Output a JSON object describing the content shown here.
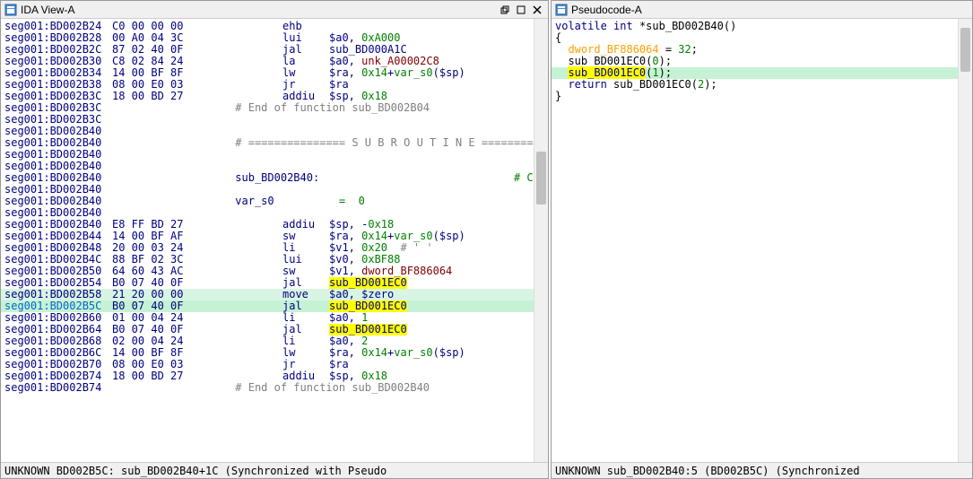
{
  "left": {
    "title": "IDA View-A",
    "status": "UNKNOWN BD002B5C: sub_BD002B40+1C (Synchronized with Pseudo",
    "lines": [
      {
        "addr": "seg001:BD002B24",
        "bytes": "C0 00 00 00",
        "mnem": "ehb",
        "op": ""
      },
      {
        "addr": "seg001:BD002B28",
        "bytes": "00 A0 04 3C",
        "mnem": "lui",
        "op": "$a0, 0xA000",
        "opparts": [
          {
            "t": "$a0, "
          },
          {
            "t": "0xA000",
            "c": "num"
          }
        ]
      },
      {
        "addr": "seg001:BD002B2C",
        "bytes": "87 02 40 0F",
        "mnem": "jal",
        "op": "sub_BD000A1C",
        "opparts": [
          {
            "t": "sub_BD000A1C",
            "c": ""
          }
        ]
      },
      {
        "addr": "seg001:BD002B30",
        "bytes": "C8 02 84 24",
        "mnem": "la",
        "op": "$a0, unk_A00002C8",
        "opparts": [
          {
            "t": "$a0, "
          },
          {
            "t": "unk_A00002C8",
            "c": "ref"
          }
        ]
      },
      {
        "addr": "seg001:BD002B34",
        "bytes": "14 00 BF 8F",
        "mnem": "lw",
        "op": "$ra, 0x14+var_s0($sp)",
        "opparts": [
          {
            "t": "$ra, "
          },
          {
            "t": "0x14",
            "c": "num"
          },
          {
            "t": "+"
          },
          {
            "t": "var_s0",
            "c": "num"
          },
          {
            "t": "($sp)"
          }
        ]
      },
      {
        "addr": "seg001:BD002B38",
        "bytes": "08 00 E0 03",
        "mnem": "jr",
        "op": "$ra"
      },
      {
        "addr": "seg001:BD002B3C",
        "bytes": "18 00 BD 27",
        "mnem": "addiu",
        "op": "$sp, 0x18",
        "opparts": [
          {
            "t": "$sp, "
          },
          {
            "t": "0x18",
            "c": "num"
          }
        ]
      },
      {
        "addr": "seg001:BD002B3C",
        "cmt": "# End of function sub_BD002B04"
      },
      {
        "addr": "seg001:BD002B3C"
      },
      {
        "addr": "seg001:BD002B40"
      },
      {
        "addr": "seg001:BD002B40",
        "cmt": "# =============== S U B R O U T I N E ========="
      },
      {
        "addr": "seg001:BD002B40"
      },
      {
        "addr": "seg001:BD002B40"
      },
      {
        "addr": "seg001:BD002B40",
        "label": "sub_BD002B40:",
        "xref": "# CODE XREF: SY"
      },
      {
        "addr": "seg001:BD002B40"
      },
      {
        "addr": "seg001:BD002B40",
        "label": "var_s0",
        "eq": "=  0"
      },
      {
        "addr": "seg001:BD002B40"
      },
      {
        "addr": "seg001:BD002B40",
        "bytes": "E8 FF BD 27",
        "mnem": "addiu",
        "op": "$sp, -0x18",
        "opparts": [
          {
            "t": "$sp, -"
          },
          {
            "t": "0x18",
            "c": "num"
          }
        ]
      },
      {
        "addr": "seg001:BD002B44",
        "bytes": "14 00 BF AF",
        "mnem": "sw",
        "op": "$ra, 0x14+var_s0($sp)",
        "opparts": [
          {
            "t": "$ra, "
          },
          {
            "t": "0x14",
            "c": "num"
          },
          {
            "t": "+"
          },
          {
            "t": "var_s0",
            "c": "num"
          },
          {
            "t": "($sp)"
          }
        ]
      },
      {
        "addr": "seg001:BD002B48",
        "bytes": "20 00 03 24",
        "mnem": "li",
        "op": "$v1, 0x20  # ' '",
        "opparts": [
          {
            "t": "$v1, "
          },
          {
            "t": "0x20",
            "c": "num"
          },
          {
            "t": "  # ' '",
            "c": "cmt"
          }
        ]
      },
      {
        "addr": "seg001:BD002B4C",
        "bytes": "88 BF 02 3C",
        "mnem": "lui",
        "op": "$v0, 0xBF88",
        "opparts": [
          {
            "t": "$v0, "
          },
          {
            "t": "0xBF88",
            "c": "num"
          }
        ]
      },
      {
        "addr": "seg001:BD002B50",
        "bytes": "64 60 43 AC",
        "mnem": "sw",
        "op": "$v1, dword_BF886064",
        "opparts": [
          {
            "t": "$v1, "
          },
          {
            "t": "dword_BF886064",
            "c": "ref"
          }
        ]
      },
      {
        "addr": "seg001:BD002B54",
        "bytes": "B0 07 40 0F",
        "mnem": "jal",
        "op": "sub_BD001EC0",
        "hl": true
      },
      {
        "addr": "seg001:BD002B58",
        "bytes": "21 20 00 00",
        "mnem": "move",
        "op": "$a0, $zero",
        "sel": "sel2"
      },
      {
        "addr": "seg001:BD002B5C",
        "bytes": "B0 07 40 0F",
        "mnem": "jal",
        "op": "sub_BD001EC0",
        "hl": true,
        "sel": "sel",
        "cur": true
      },
      {
        "addr": "seg001:BD002B60",
        "bytes": "01 00 04 24",
        "mnem": "li",
        "op": "$a0, 1",
        "opparts": [
          {
            "t": "$a0, "
          },
          {
            "t": "1",
            "c": "num"
          }
        ]
      },
      {
        "addr": "seg001:BD002B64",
        "bytes": "B0 07 40 0F",
        "mnem": "jal",
        "op": "sub_BD001EC0",
        "hl": true
      },
      {
        "addr": "seg001:BD002B68",
        "bytes": "02 00 04 24",
        "mnem": "li",
        "op": "$a0, 2",
        "opparts": [
          {
            "t": "$a0, "
          },
          {
            "t": "2",
            "c": "num"
          }
        ]
      },
      {
        "addr": "seg001:BD002B6C",
        "bytes": "14 00 BF 8F",
        "mnem": "lw",
        "op": "$ra, 0x14+var_s0($sp)",
        "opparts": [
          {
            "t": "$ra, "
          },
          {
            "t": "0x14",
            "c": "num"
          },
          {
            "t": "+"
          },
          {
            "t": "var_s0",
            "c": "num"
          },
          {
            "t": "($sp)"
          }
        ]
      },
      {
        "addr": "seg001:BD002B70",
        "bytes": "08 00 E0 03",
        "mnem": "jr",
        "op": "$ra"
      },
      {
        "addr": "seg001:BD002B74",
        "bytes": "18 00 BD 27",
        "mnem": "addiu",
        "op": "$sp, 0x18",
        "opparts": [
          {
            "t": "$sp, "
          },
          {
            "t": "0x18",
            "c": "num"
          }
        ]
      },
      {
        "addr": "seg001:BD002B74",
        "cmt": "# End of function sub_BD002B40"
      }
    ]
  },
  "right": {
    "title": "Pseudocode-A",
    "status": "UNKNOWN sub_BD002B40:5 (BD002B5C) (Synchronized",
    "lines": [
      {
        "parts": [
          {
            "t": "volatile",
            "c": "kw"
          },
          {
            "t": " "
          },
          {
            "t": "int",
            "c": "kw"
          },
          {
            "t": " *sub_BD002B40()"
          }
        ]
      },
      {
        "parts": [
          {
            "t": "{"
          }
        ]
      },
      {
        "parts": [
          {
            "t": "  "
          },
          {
            "t": "dword_BF886064",
            "c": "loc"
          },
          {
            "t": " = "
          },
          {
            "t": "32",
            "c": "p-num"
          },
          {
            "t": ";"
          }
        ]
      },
      {
        "parts": [
          {
            "t": "  sub_BD001EC0("
          },
          {
            "t": "0",
            "c": "p-num"
          },
          {
            "t": ");"
          }
        ]
      },
      {
        "sel": true,
        "parts": [
          {
            "t": "  "
          },
          {
            "t": "sub_BD001EC0",
            "c": "hl-yellow"
          },
          {
            "t": "("
          },
          {
            "t": "1",
            "c": "p-num"
          },
          {
            "t": ");"
          }
        ]
      },
      {
        "parts": [
          {
            "t": "  "
          },
          {
            "t": "return",
            "c": "kw"
          },
          {
            "t": " sub_BD001EC0("
          },
          {
            "t": "2",
            "c": "p-num"
          },
          {
            "t": ");"
          }
        ]
      },
      {
        "parts": [
          {
            "t": "}"
          }
        ]
      }
    ]
  }
}
